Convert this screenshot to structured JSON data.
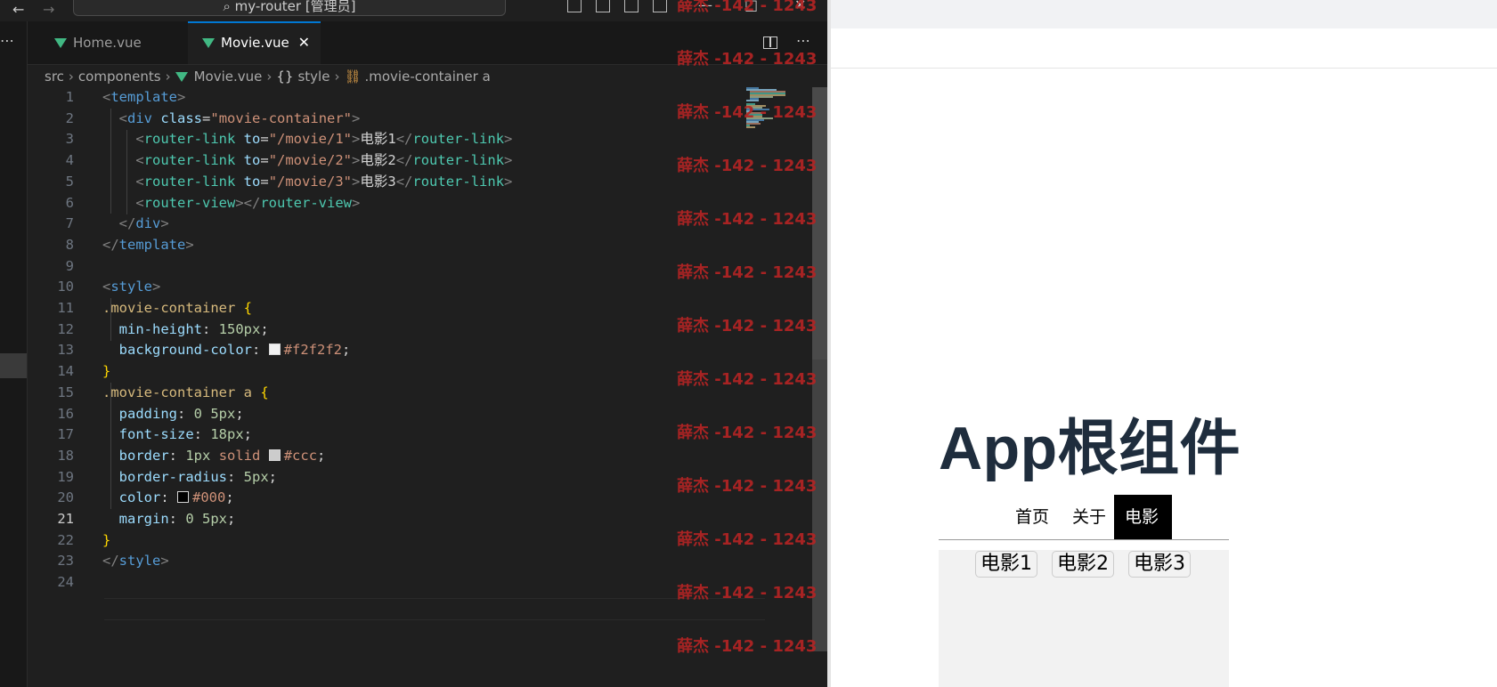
{
  "titlebar": {
    "back_icon": "arrow-left-icon",
    "forward_icon": "arrow-right-icon",
    "command_center": "my-router [管理员]",
    "search_icon": "search-icon"
  },
  "tabs": [
    {
      "label": "Home.vue",
      "icon": "vue-icon"
    },
    {
      "label": "Movie.vue",
      "icon": "vue-icon",
      "close": "✕"
    }
  ],
  "breadcrumb": {
    "items": [
      "src",
      "components",
      "Movie.vue",
      "style",
      ".movie-container a"
    ],
    "separator": "›"
  },
  "code": {
    "lines": [
      {
        "n": "1",
        "tokens": [
          [
            "t-br",
            "<"
          ],
          [
            "t-tag",
            "template"
          ],
          [
            "t-br",
            ">"
          ]
        ]
      },
      {
        "n": "2",
        "tokens": [
          [
            "t-pn",
            "  "
          ],
          [
            "t-br",
            "<"
          ],
          [
            "t-tag",
            "div"
          ],
          [
            "t-pn",
            " "
          ],
          [
            "t-attr",
            "class"
          ],
          [
            "t-pn",
            "="
          ],
          [
            "t-str",
            "\"movie-container\""
          ],
          [
            "t-br",
            ">"
          ]
        ]
      },
      {
        "n": "3",
        "tokens": [
          [
            "t-pn",
            "    "
          ],
          [
            "t-br",
            "<"
          ],
          [
            "t-rl",
            "router-link"
          ],
          [
            "t-pn",
            " "
          ],
          [
            "t-attr",
            "to"
          ],
          [
            "t-pn",
            "="
          ],
          [
            "t-str",
            "\"/movie/1\""
          ],
          [
            "t-br",
            ">"
          ],
          [
            "t-txt",
            "电影1"
          ],
          [
            "t-br",
            "</"
          ],
          [
            "t-rl",
            "router-link"
          ],
          [
            "t-br",
            ">"
          ]
        ]
      },
      {
        "n": "4",
        "tokens": [
          [
            "t-pn",
            "    "
          ],
          [
            "t-br",
            "<"
          ],
          [
            "t-rl",
            "router-link"
          ],
          [
            "t-pn",
            " "
          ],
          [
            "t-attr",
            "to"
          ],
          [
            "t-pn",
            "="
          ],
          [
            "t-str",
            "\"/movie/2\""
          ],
          [
            "t-br",
            ">"
          ],
          [
            "t-txt",
            "电影2"
          ],
          [
            "t-br",
            "</"
          ],
          [
            "t-rl",
            "router-link"
          ],
          [
            "t-br",
            ">"
          ]
        ]
      },
      {
        "n": "5",
        "tokens": [
          [
            "t-pn",
            "    "
          ],
          [
            "t-br",
            "<"
          ],
          [
            "t-rl",
            "router-link"
          ],
          [
            "t-pn",
            " "
          ],
          [
            "t-attr",
            "to"
          ],
          [
            "t-pn",
            "="
          ],
          [
            "t-str",
            "\"/movie/3\""
          ],
          [
            "t-br",
            ">"
          ],
          [
            "t-txt",
            "电影3"
          ],
          [
            "t-br",
            "</"
          ],
          [
            "t-rl",
            "router-link"
          ],
          [
            "t-br",
            ">"
          ]
        ]
      },
      {
        "n": "6",
        "tokens": [
          [
            "t-pn",
            "    "
          ],
          [
            "t-br",
            "<"
          ],
          [
            "t-rl",
            "router-view"
          ],
          [
            "t-br",
            "></"
          ],
          [
            "t-rl",
            "router-view"
          ],
          [
            "t-br",
            ">"
          ]
        ]
      },
      {
        "n": "7",
        "tokens": [
          [
            "t-pn",
            "  "
          ],
          [
            "t-br",
            "</"
          ],
          [
            "t-tag",
            "div"
          ],
          [
            "t-br",
            ">"
          ]
        ]
      },
      {
        "n": "8",
        "tokens": [
          [
            "t-br",
            "</"
          ],
          [
            "t-tag",
            "template"
          ],
          [
            "t-br",
            ">"
          ]
        ]
      },
      {
        "n": "9",
        "tokens": []
      },
      {
        "n": "10",
        "tokens": [
          [
            "t-br",
            "<"
          ],
          [
            "t-tag",
            "style"
          ],
          [
            "t-br",
            ">"
          ]
        ]
      },
      {
        "n": "11",
        "tokens": [
          [
            "t-sel",
            ".movie-container"
          ],
          [
            "t-pn",
            " "
          ],
          [
            "t-cb",
            "{"
          ]
        ]
      },
      {
        "n": "12",
        "tokens": [
          [
            "t-pn",
            "  "
          ],
          [
            "t-prop",
            "min-height"
          ],
          [
            "t-pn",
            ": "
          ],
          [
            "t-num",
            "150px"
          ],
          [
            "t-pn",
            ";"
          ]
        ]
      },
      {
        "n": "13",
        "tokens": [
          [
            "t-pn",
            "  "
          ],
          [
            "t-prop",
            "background-color"
          ],
          [
            "t-pn",
            ": "
          ],
          [
            "swatch",
            "#f2f2f2"
          ],
          [
            "t-val",
            "#f2f2f2"
          ],
          [
            "t-pn",
            ";"
          ]
        ]
      },
      {
        "n": "14",
        "tokens": [
          [
            "t-cb",
            "}"
          ]
        ]
      },
      {
        "n": "15",
        "tokens": [
          [
            "t-sel",
            ".movie-container a"
          ],
          [
            "t-pn",
            " "
          ],
          [
            "t-cb",
            "{"
          ]
        ]
      },
      {
        "n": "16",
        "tokens": [
          [
            "t-pn",
            "  "
          ],
          [
            "t-prop",
            "padding"
          ],
          [
            "t-pn",
            ": "
          ],
          [
            "t-num",
            "0 5px"
          ],
          [
            "t-pn",
            ";"
          ]
        ]
      },
      {
        "n": "17",
        "tokens": [
          [
            "t-pn",
            "  "
          ],
          [
            "t-prop",
            "font-size"
          ],
          [
            "t-pn",
            ": "
          ],
          [
            "t-num",
            "18px"
          ],
          [
            "t-pn",
            ";"
          ]
        ]
      },
      {
        "n": "18",
        "tokens": [
          [
            "t-pn",
            "  "
          ],
          [
            "t-prop",
            "border"
          ],
          [
            "t-pn",
            ": "
          ],
          [
            "t-num",
            "1px"
          ],
          [
            "t-pn",
            " "
          ],
          [
            "t-val",
            "solid"
          ],
          [
            "t-pn",
            " "
          ],
          [
            "swatch",
            "#cccccc"
          ],
          [
            "t-val",
            "#ccc"
          ],
          [
            "t-pn",
            ";"
          ]
        ]
      },
      {
        "n": "19",
        "tokens": [
          [
            "t-pn",
            "  "
          ],
          [
            "t-prop",
            "border-radius"
          ],
          [
            "t-pn",
            ": "
          ],
          [
            "t-num",
            "5px"
          ],
          [
            "t-pn",
            ";"
          ]
        ]
      },
      {
        "n": "20",
        "tokens": [
          [
            "t-pn",
            "  "
          ],
          [
            "t-prop",
            "color"
          ],
          [
            "t-pn",
            ": "
          ],
          [
            "swatch",
            "#000000"
          ],
          [
            "t-val",
            "#000"
          ],
          [
            "t-pn",
            ";"
          ]
        ]
      },
      {
        "n": "21",
        "tokens": [
          [
            "t-pn",
            "  "
          ],
          [
            "t-prop",
            "margin"
          ],
          [
            "t-pn",
            ": "
          ],
          [
            "t-num",
            "0 5px"
          ],
          [
            "t-pn",
            ";"
          ]
        ]
      },
      {
        "n": "22",
        "tokens": [
          [
            "t-cb",
            "}"
          ]
        ]
      },
      {
        "n": "23",
        "tokens": [
          [
            "t-br",
            "</"
          ],
          [
            "t-tag",
            "style"
          ],
          [
            "t-br",
            ">"
          ]
        ]
      },
      {
        "n": "24",
        "tokens": []
      }
    ],
    "active_line": "21"
  },
  "watermark": "薛杰 -142 - 1243",
  "browser": {
    "app_title": "App根组件",
    "nav": [
      {
        "label": "首页",
        "active": false
      },
      {
        "label": "关于",
        "active": false
      },
      {
        "label": "电影",
        "active": true
      }
    ],
    "movies": [
      "电影1",
      "电影2",
      "电影3"
    ]
  },
  "colors": {
    "editor_bg": "#1f1f1f",
    "accent": "#0078d4",
    "vue_green": "#41b883",
    "watermark": "#b32424",
    "title_text": "#1f2d3d",
    "movie_bg": "#f2f2f2"
  }
}
